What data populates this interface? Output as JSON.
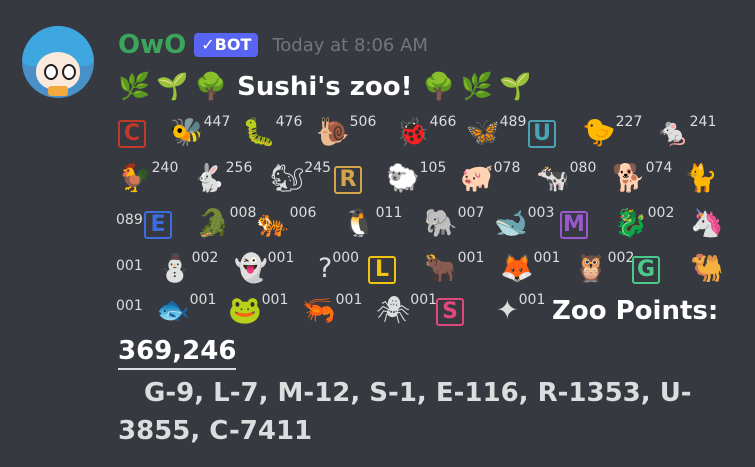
{
  "message": {
    "author": "OwO",
    "bot_tag": "BOT",
    "bot_check": "✓",
    "timestamp": "Today at 8:06 AM",
    "title": "Sushi's zoo!",
    "title_emojis_left": [
      "🌿",
      "🌱",
      "🌳"
    ],
    "title_emojis_right": [
      "🌳",
      "🌿",
      "🌱"
    ]
  },
  "rows": [
    [
      {
        "name": "rank-c",
        "icon": "C",
        "color": "#c0392b",
        "count": ""
      },
      {
        "name": "bee",
        "icon": "🐝",
        "count": "447"
      },
      {
        "name": "caterpillar",
        "icon": "🐛",
        "count": "476"
      },
      {
        "name": "snail",
        "icon": "🐌",
        "count": "506"
      },
      {
        "name": "ladybug",
        "icon": "🐞",
        "count": "466"
      },
      {
        "name": "butterfly",
        "icon": "🦋",
        "count": "489"
      },
      {
        "name": "rank-u",
        "icon": "U",
        "color": "#4aa3b5",
        "count": ""
      },
      {
        "name": "chick",
        "icon": "🐤",
        "count": "227"
      },
      {
        "name": "mouse",
        "icon": "🐁",
        "count": "241"
      }
    ],
    [
      {
        "name": "rooster",
        "icon": "🐓",
        "count": "240"
      },
      {
        "name": "rabbit",
        "icon": "🐇",
        "count": "256"
      },
      {
        "name": "chipmunk",
        "icon": "🐿",
        "count": "245"
      },
      {
        "name": "rank-r",
        "icon": "R",
        "color": "#d4a548",
        "count": ""
      },
      {
        "name": "sheep",
        "icon": "🐑",
        "count": "105"
      },
      {
        "name": "pig",
        "icon": "🐖",
        "count": "078"
      },
      {
        "name": "cow",
        "icon": "🐄",
        "count": "080"
      },
      {
        "name": "dog",
        "icon": "🐕",
        "count": "074"
      },
      {
        "name": "cat",
        "icon": "🐈",
        "count": ""
      }
    ],
    [
      {
        "name": "rank-e",
        "icon": "E",
        "color": "#3d6ee0",
        "count": ""
      },
      {
        "name": "crocodile",
        "icon": "🐊",
        "count": "008"
      },
      {
        "name": "tiger",
        "icon": "🐅",
        "count": "006"
      },
      {
        "name": "toucan",
        "icon": "🐧",
        "count": "011"
      },
      {
        "name": "elephant",
        "icon": "🐘",
        "count": "007"
      },
      {
        "name": "whale",
        "icon": "🐋",
        "count": "003"
      },
      {
        "name": "rank-m",
        "icon": "M",
        "color": "#9b59d0",
        "count": ""
      },
      {
        "name": "dragon",
        "icon": "🐉",
        "count": "002"
      },
      {
        "name": "unicorn",
        "icon": "🦄",
        "count": ""
      }
    ],
    [
      {
        "name": "snowman",
        "icon": "⛄",
        "count": "002"
      },
      {
        "name": "ghost",
        "icon": "👻",
        "count": "001"
      },
      {
        "name": "question",
        "icon": "?",
        "count": "000"
      },
      {
        "name": "rank-l",
        "icon": "L",
        "color": "#f1c40f",
        "count": ""
      },
      {
        "name": "ox",
        "icon": "🐂",
        "count": "001"
      },
      {
        "name": "fox",
        "icon": "🦊",
        "count": "001"
      },
      {
        "name": "owl",
        "icon": "🦉",
        "count": "002"
      },
      {
        "name": "rank-g",
        "icon": "G",
        "color": "#4cc98a",
        "count": ""
      },
      {
        "name": "camel",
        "icon": "🐫",
        "count": ""
      }
    ],
    [
      {
        "name": "fish",
        "icon": "🐟",
        "count": "001"
      },
      {
        "name": "frog",
        "icon": "🐸",
        "count": "001"
      },
      {
        "name": "shrimp",
        "icon": "🦐",
        "count": "001"
      },
      {
        "name": "spider",
        "icon": "🕷",
        "count": "001"
      },
      {
        "name": "rank-s",
        "icon": "S",
        "color": "#e0477a",
        "count": ""
      },
      {
        "name": "mystery",
        "icon": "✦",
        "count": "001"
      }
    ]
  ],
  "leading_counts": [
    "089",
    "001",
    "001"
  ],
  "zoo_points_label": "Zoo Points:",
  "zoo_points_value": "369,246",
  "summary": "G-9, L-7, M-12, S-1, E-116, R-1353, U-3855, C-7411"
}
